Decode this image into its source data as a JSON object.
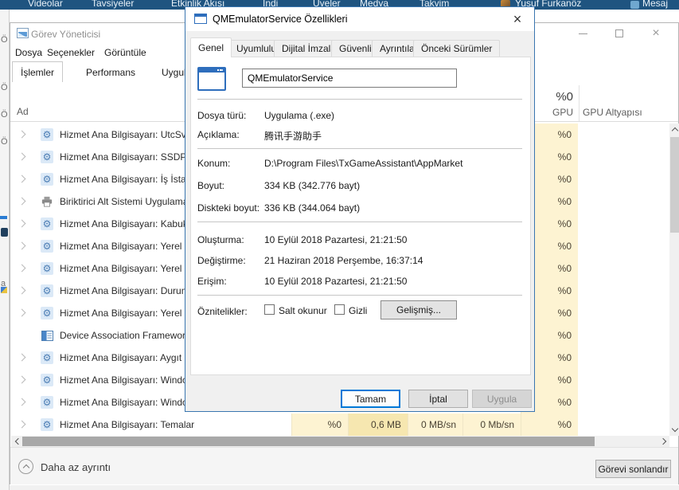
{
  "navbar": {
    "items": [
      "Videolar",
      "Tavsiyeler",
      "Etkinlik Akışı",
      "İndi",
      "Üyeler",
      "Medya",
      "Takvim"
    ],
    "user_name": "Yusuf Furkanöz",
    "message_label": "Mesaj"
  },
  "background_window": {
    "fragments": [
      "Ö",
      "Ö",
      "Ö",
      "Ö",
      "a"
    ]
  },
  "task_manager": {
    "title": "Görev Yöneticisi",
    "menu_items": [
      "Dosya",
      "Seçenekler",
      "Görüntüle"
    ],
    "tabs": [
      "İşlemler",
      "Performans",
      "Uygulama geçmi"
    ],
    "name_column": "Ad",
    "gpu_column": {
      "usage": "%0",
      "label": "GPU"
    },
    "gpu_engine_column": "GPU Altyapısı",
    "processes": [
      {
        "name": "Hizmet Ana Bilgisayarı: UtcSvc",
        "icon": "gear",
        "gpu": "%0"
      },
      {
        "name": "Hizmet Ana Bilgisayarı: SSDP ...",
        "icon": "gear",
        "gpu": "%0"
      },
      {
        "name": "Hizmet Ana Bilgisayarı: İş İsta...",
        "icon": "gear",
        "gpu": "%0"
      },
      {
        "name": "Biriktirici Alt Sistemi Uygulaması",
        "icon": "printer",
        "gpu": "%0"
      },
      {
        "name": "Hizmet Ana Bilgisayarı: Kabuk D...",
        "icon": "gear",
        "gpu": "%0"
      },
      {
        "name": "Hizmet Ana Bilgisayarı: Yerel Hiz...",
        "icon": "gear",
        "gpu": "%0"
      },
      {
        "name": "Hizmet Ana Bilgisayarı: Yerel Hiz...",
        "icon": "gear",
        "gpu": "%0"
      },
      {
        "name": "Hizmet Ana Bilgisayarı: Durum ...",
        "icon": "gear",
        "gpu": "%0"
      },
      {
        "name": "Hizmet Ana Bilgisayarı: Yerel Hiz...",
        "icon": "gear",
        "gpu": "%0"
      },
      {
        "name": "Device Association Framework ...",
        "icon": "window",
        "gpu": "%0"
      },
      {
        "name": "Hizmet Ana Bilgisayarı: Aygıt İliş...",
        "icon": "gear",
        "gpu": "%0"
      },
      {
        "name": "Hizmet Ana Bilgisayarı: Window...",
        "icon": "gear",
        "gpu": "%0"
      },
      {
        "name": "Hizmet Ana Bilgisayarı: Window...",
        "icon": "gear",
        "gpu": "%0"
      },
      {
        "name": "Hizmet Ana Bilgisayarı: Temalar",
        "icon": "gear",
        "gpu": "%0",
        "cpu": "%0",
        "memory": "0,6 MB",
        "disk": "0 MB/sn",
        "network": "0 Mb/sn"
      }
    ],
    "footer": {
      "details_toggle": "Daha az ayrıntı",
      "end_task_button": "Görevi sonlandır"
    }
  },
  "properties_dialog": {
    "title": "QMEmulatorService Özellikleri",
    "tabs": [
      "Genel",
      "Uyumluluk",
      "Dijital İmzalar",
      "Güvenlik",
      "Ayrıntılar",
      "Önceki Sürümler"
    ],
    "active_tab": "Genel",
    "file_name": "QMEmulatorService",
    "fields": [
      {
        "label": "Dosya türü:",
        "value": "Uygulama (.exe)"
      },
      {
        "label": "Açıklama:",
        "value": "腾讯手游助手"
      },
      {
        "label": "Konum:",
        "value": "D:\\Program Files\\TxGameAssistant\\AppMarket"
      },
      {
        "label": "Boyut:",
        "value": "334 KB (342.776 bayt)"
      },
      {
        "label": "Diskteki boyut:",
        "value": "336 KB (344.064 bayt)"
      },
      {
        "label": "Oluşturma:",
        "value": "10 Eylül 2018 Pazartesi, 21:21:50"
      },
      {
        "label": "Değiştirme:",
        "value": "21 Haziran 2018 Perşembe, 16:37:14"
      },
      {
        "label": "Erişim:",
        "value": "10 Eylül 2018 Pazartesi, 21:21:50"
      }
    ],
    "attributes": {
      "label": "Öznitelikler:",
      "readonly_label": "Salt okunur",
      "hidden_label": "Gizli",
      "advanced_button": "Gelişmiş..."
    },
    "buttons": {
      "ok": "Tamam",
      "cancel": "İptal",
      "apply": "Uygula"
    }
  },
  "colors": {
    "accent_blue": "#0078d7",
    "navbar_blue": "#1f5480",
    "cell_yellow": "#fdf3d2",
    "cell_yellow_dark": "#f6e7b0"
  }
}
